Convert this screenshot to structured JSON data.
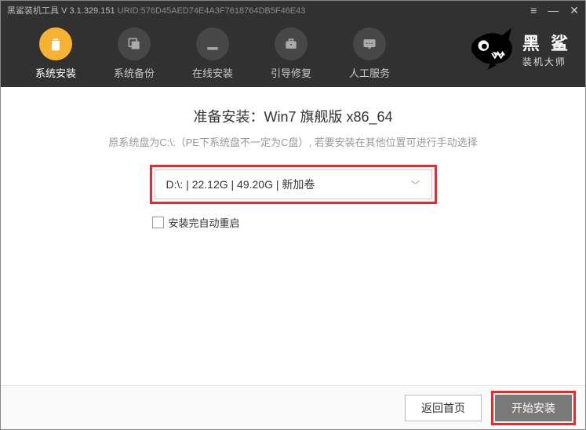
{
  "titlebar": {
    "app_name": "黑鲨装机工具",
    "version_prefix": "V",
    "version": "3.1.329.151",
    "urid_label": "URID:",
    "urid": "576D45AED74E4A3F7618764DB5F46E43"
  },
  "toolbar": {
    "items": [
      {
        "label": "系统安装",
        "icon": "trash"
      },
      {
        "label": "系统备份",
        "icon": "copy"
      },
      {
        "label": "在线安装",
        "icon": "download"
      },
      {
        "label": "引导修复",
        "icon": "toolbox"
      },
      {
        "label": "人工服务",
        "icon": "chat"
      }
    ]
  },
  "logo": {
    "title": "黑 鲨",
    "subtitle": "装机大师"
  },
  "content": {
    "prepare_prefix": "准备安装：",
    "prepare_target": "Win7 旗舰版 x86_64",
    "note": "原系统盘为C:\\:（PE下系统盘不一定为C盘）, 若要安装在其他位置可进行手动选择",
    "drive_selected": "D:\\: | 22.12G | 49.20G | 新加卷",
    "checkbox_label": "安装完自动重启"
  },
  "footer": {
    "back_label": "返回首页",
    "start_label": "开始安装"
  }
}
